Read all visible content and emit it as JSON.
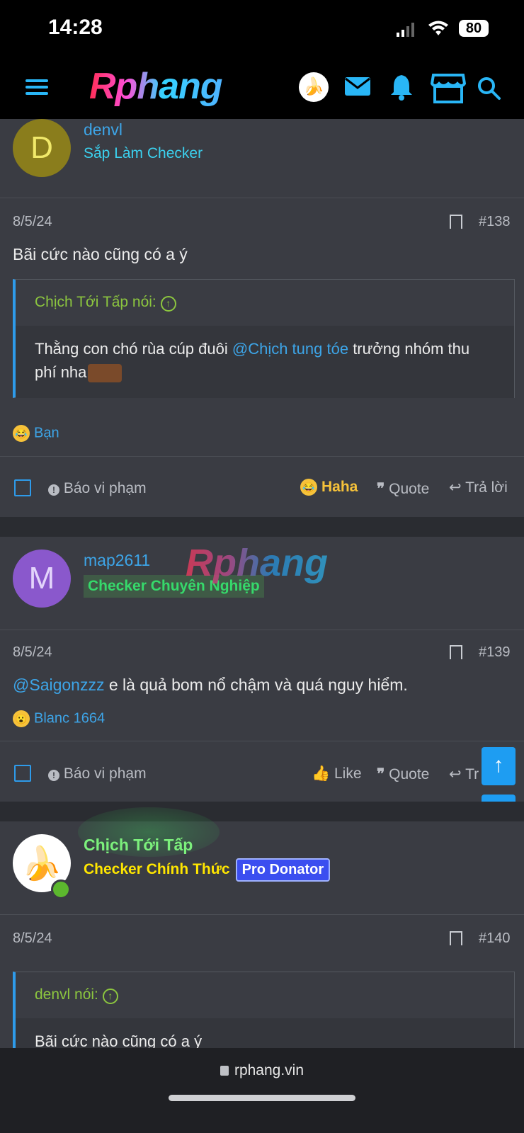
{
  "status_bar": {
    "time": "14:28",
    "battery": "80"
  },
  "header": {
    "logo_text": "Rphang"
  },
  "posts": [
    {
      "username": "denvl",
      "user_title": "Sắp Làm Checker",
      "avatar_letter": "D",
      "date": "8/5/24",
      "post_number": "#138",
      "body": "Bãi cức nào cũng có a ý",
      "quote_author": "Chịch Tới Tấp nói:",
      "quote_text_before": "Thằng con chó rùa cúp đuôi ",
      "quote_mention": "@Chịch tung tóe",
      "quote_text_after": " trưởng nhóm thu phí nha",
      "reaction_user": "Bạn",
      "actions": {
        "report": "Báo vi phạm",
        "react": "Haha",
        "quote": "Quote",
        "reply": "Trả lời"
      }
    },
    {
      "username": "map2611",
      "user_title": "Checker Chuyên Nghiệp",
      "avatar_letter": "M",
      "date": "8/5/24",
      "post_number": "#139",
      "body_mention": "@Saigonzzz",
      "body_text": " e là quả bom nổ chậm và quá nguy hiểm.",
      "reaction_user": "Blanc 1664",
      "actions": {
        "report": "Báo vi phạm",
        "like": "Like",
        "quote": "Quote",
        "reply": "Tr"
      }
    },
    {
      "username": "Chịch Tới Tấp",
      "user_title": "Checker Chính Thức",
      "badge": "Pro Donator",
      "date": "8/5/24",
      "post_number": "#140",
      "quote_author": "denvl nói:",
      "quote_text": "Bãi cức nào cũng có a ý"
    }
  ],
  "watermark": "Rphang",
  "browser": {
    "url": "rphang.vin"
  },
  "colors": {
    "accent": "#2e9bea",
    "link": "#3da5e8",
    "quote_author": "#8cc63f",
    "haha": "#f6c23a"
  }
}
